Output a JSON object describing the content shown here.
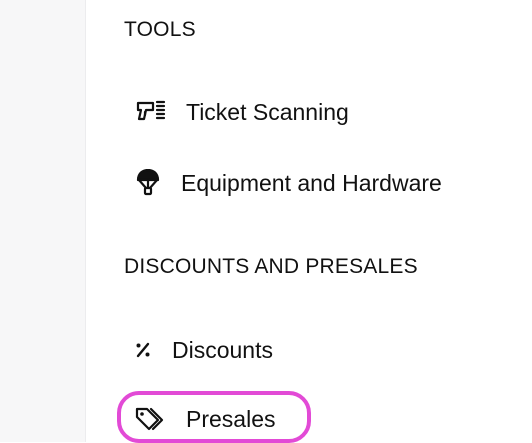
{
  "sidebar": {
    "sections": [
      {
        "heading": "TOOLS",
        "items": [
          {
            "label": "Ticket Scanning",
            "icon": "scanner-gun-icon"
          },
          {
            "label": "Equipment and Hardware",
            "icon": "parachute-icon"
          }
        ]
      },
      {
        "heading": "DISCOUNTS AND PRESALES",
        "items": [
          {
            "label": "Discounts",
            "icon": "percent-icon"
          },
          {
            "label": "Presales",
            "icon": "tags-icon",
            "highlighted": true
          }
        ]
      }
    ],
    "highlight_color": "#e24ad6"
  }
}
